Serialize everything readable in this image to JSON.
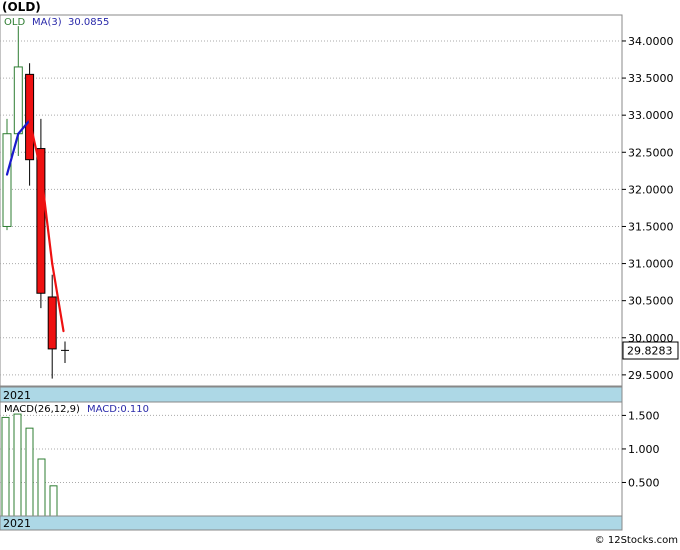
{
  "header": {
    "symbol": "(OLD)"
  },
  "price_panel": {
    "legend_symbol": "OLD",
    "ma_label": "MA(3)",
    "ma_value": "30.0855",
    "last_price_label": "29.8283",
    "year_label": "2021"
  },
  "macd_panel": {
    "title": "MACD(26,12,9)",
    "macd_value_label": "MACD:0.110",
    "year_label": "2021"
  },
  "footer": {
    "watermark": "© 12Stocks.com"
  },
  "colors": {
    "up": "#2e7d32",
    "down": "#ee1111",
    "ma_up": "#1a1acc",
    "ma_down": "#ee1111",
    "grid": "#aaaaaa",
    "band": "#add8e6",
    "macd_bar": "#2e7d32",
    "legend_text": "#2a2aaa",
    "symbol_text": "#2e7d32"
  },
  "chart_data": [
    {
      "type": "candlestick",
      "name_label": "OLD",
      "ylim": [
        29.35,
        34.35
      ],
      "yticks": [
        29.5,
        30.0,
        30.5,
        31.0,
        31.5,
        32.0,
        32.5,
        33.0,
        33.5,
        34.0
      ],
      "ytick_labels": [
        "29.5000",
        "30.0000",
        "30.5000",
        "31.0000",
        "31.5000",
        "32.0000",
        "32.5000",
        "33.0000",
        "33.5000",
        "34.0000"
      ],
      "last_price": 29.8283,
      "candles": [
        {
          "open": 31.5,
          "high": 32.95,
          "low": 31.45,
          "close": 32.75
        },
        {
          "open": 32.75,
          "high": 34.2,
          "low": 32.45,
          "close": 33.65
        },
        {
          "open": 33.55,
          "high": 33.7,
          "low": 32.05,
          "close": 32.4
        },
        {
          "open": 32.55,
          "high": 32.95,
          "low": 30.4,
          "close": 30.6
        },
        {
          "open": 30.55,
          "high": 30.85,
          "low": 29.45,
          "close": 29.85
        },
        {
          "open": 29.83,
          "high": 29.95,
          "low": 29.66,
          "close": 29.83
        }
      ],
      "ma": {
        "label": "MA(3)",
        "values": [
          32.2,
          32.75,
          32.93,
          32.25,
          31.0,
          30.09
        ]
      },
      "x_label": "2021"
    },
    {
      "type": "bar",
      "title": "MACD(26,12,9)",
      "ylim": [
        0.0,
        1.7
      ],
      "yticks": [
        0.5,
        1.0,
        1.5
      ],
      "ytick_labels": [
        "0.500",
        "1.000",
        "1.500"
      ],
      "values": [
        1.47,
        1.52,
        1.31,
        0.85,
        0.45
      ],
      "last_value": 0.11,
      "x_label": "2021"
    }
  ]
}
